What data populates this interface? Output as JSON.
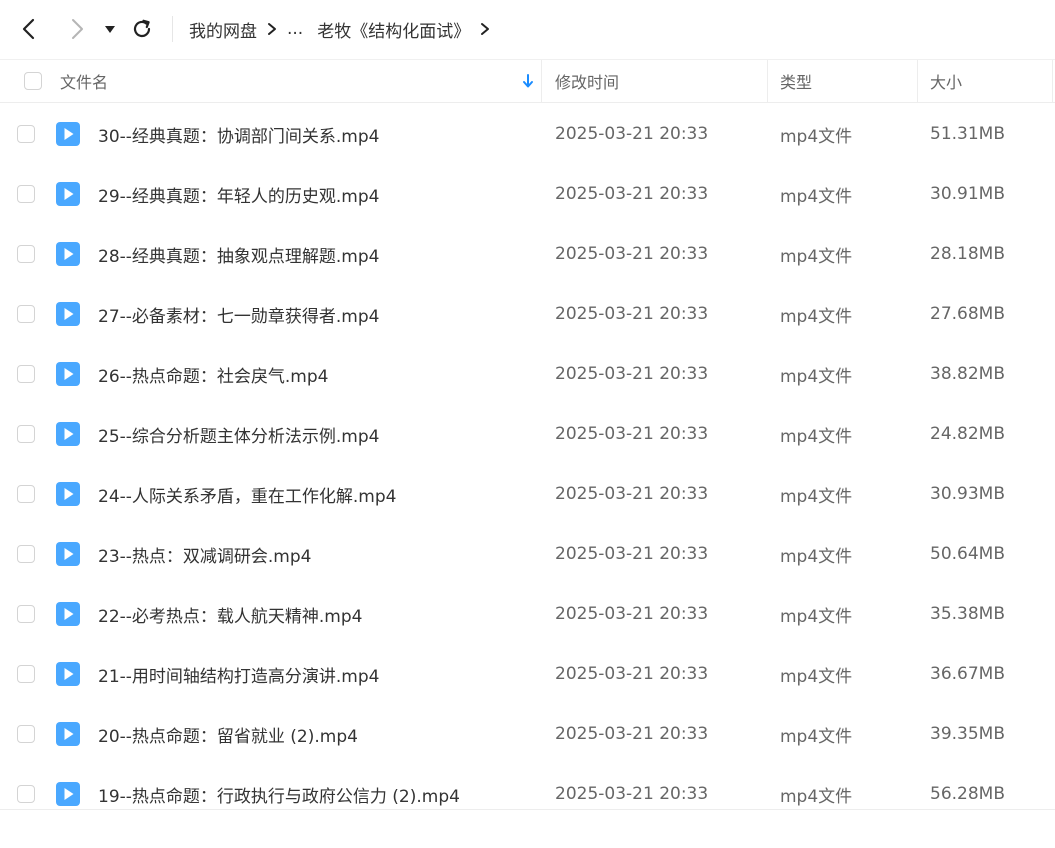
{
  "nav": {
    "back_icon": "chevron-left-icon",
    "forward_icon": "chevron-right-icon",
    "history_icon": "caret-down-icon",
    "refresh_icon": "refresh-icon"
  },
  "breadcrumb": {
    "root": "我的网盘",
    "ellipsis": "...",
    "current": "老牧《结构化面试》"
  },
  "columns": {
    "name": "文件名",
    "mtime": "修改时间",
    "type": "类型",
    "size": "大小"
  },
  "colors": {
    "accent": "#1a8cff",
    "file_icon": "#4aa8ff"
  },
  "files": [
    {
      "name": "30--经典真题：协调部门间关系.mp4",
      "mtime": "2025-03-21 20:33",
      "type": "mp4文件",
      "size": "51.31MB"
    },
    {
      "name": "29--经典真题：年轻人的历史观.mp4",
      "mtime": "2025-03-21 20:33",
      "type": "mp4文件",
      "size": "30.91MB"
    },
    {
      "name": "28--经典真题：抽象观点理解题.mp4",
      "mtime": "2025-03-21 20:33",
      "type": "mp4文件",
      "size": "28.18MB"
    },
    {
      "name": "27--必备素材：七一勋章获得者.mp4",
      "mtime": "2025-03-21 20:33",
      "type": "mp4文件",
      "size": "27.68MB"
    },
    {
      "name": "26--热点命题：社会戾气.mp4",
      "mtime": "2025-03-21 20:33",
      "type": "mp4文件",
      "size": "38.82MB"
    },
    {
      "name": "25--综合分析题主体分析法示例.mp4",
      "mtime": "2025-03-21 20:33",
      "type": "mp4文件",
      "size": "24.82MB"
    },
    {
      "name": "24--人际关系矛盾，重在工作化解.mp4",
      "mtime": "2025-03-21 20:33",
      "type": "mp4文件",
      "size": "30.93MB"
    },
    {
      "name": "23--热点：双减调研会.mp4",
      "mtime": "2025-03-21 20:33",
      "type": "mp4文件",
      "size": "50.64MB"
    },
    {
      "name": "22--必考热点：载人航天精神.mp4",
      "mtime": "2025-03-21 20:33",
      "type": "mp4文件",
      "size": "35.38MB"
    },
    {
      "name": "21--用时间轴结构打造高分演讲.mp4",
      "mtime": "2025-03-21 20:33",
      "type": "mp4文件",
      "size": "36.67MB"
    },
    {
      "name": "20--热点命题：留省就业 (2).mp4",
      "mtime": "2025-03-21 20:33",
      "type": "mp4文件",
      "size": "39.35MB"
    },
    {
      "name": "19--热点命题：行政执行与政府公信力 (2).mp4",
      "mtime": "2025-03-21 20:33",
      "type": "mp4文件",
      "size": "56.28MB"
    }
  ]
}
